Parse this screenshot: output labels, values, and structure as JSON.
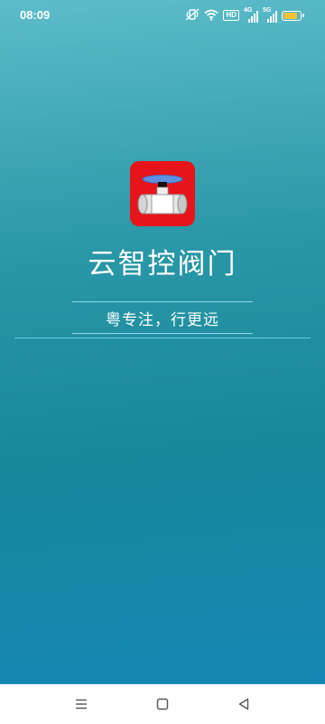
{
  "status_bar": {
    "time": "08:09",
    "hd_label": "HD",
    "signal_1_tag": "4G",
    "signal_2_tag": "5G",
    "battery_level": 0.85,
    "battery_color": "#f0c23a"
  },
  "app": {
    "title": "云智控阀门",
    "slogan": "粤专注，行更远",
    "logo_icon": "valve-icon",
    "logo_color": "#e8141b"
  },
  "nav_bar": {
    "menu_icon": "menu-icon",
    "home_icon": "home-icon",
    "back_icon": "back-icon"
  }
}
